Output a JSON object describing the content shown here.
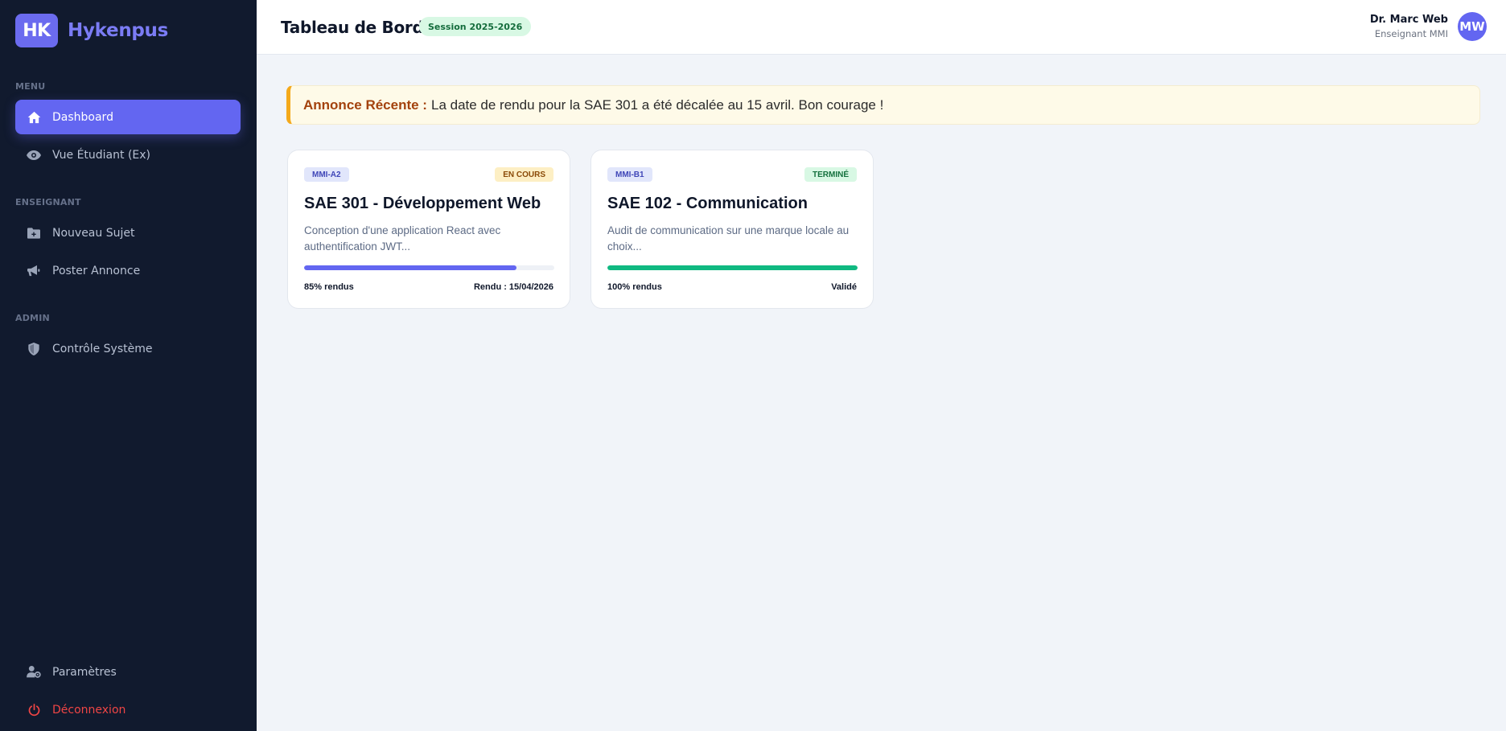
{
  "brand": {
    "logo": "HK",
    "name": "Hykenpus"
  },
  "sidebar": {
    "sections": [
      {
        "title": "MENU",
        "items": [
          {
            "label": "Dashboard",
            "icon": "home-icon",
            "active": true
          },
          {
            "label": "Vue Étudiant (Ex)",
            "icon": "eye-icon"
          }
        ]
      },
      {
        "title": "ENSEIGNANT",
        "items": [
          {
            "label": "Nouveau Sujet",
            "icon": "folder-plus-icon"
          },
          {
            "label": "Poster Annonce",
            "icon": "megaphone-icon"
          }
        ]
      },
      {
        "title": "ADMIN",
        "items": [
          {
            "label": "Contrôle Système",
            "icon": "shield-icon"
          }
        ]
      }
    ],
    "bottom": [
      {
        "label": "Paramètres",
        "icon": "user-gear-icon"
      },
      {
        "label": "Déconnexion",
        "icon": "power-icon"
      }
    ]
  },
  "header": {
    "title": "Tableau de Bord",
    "session": "Session 2025-2026",
    "user": {
      "name": "Dr. Marc Web",
      "role": "Enseignant MMI",
      "initials": "MW"
    }
  },
  "announcement": {
    "label": "Annonce Récente :",
    "text": "La date de rendu pour la SAE 301 a été décalée au 15 avril. Bon courage !"
  },
  "cards": [
    {
      "group": "MMI-A2",
      "status": "EN COURS",
      "status_bg": "#fdefc4",
      "status_fg": "#8a4a07",
      "title": "SAE 301 - Développement Web",
      "description": "Conception d'une application React avec authentification JWT...",
      "progress": 85,
      "progress_color": "#6366f1",
      "progress_label": "85% rendus",
      "right_label": "Rendu : 15/04/2026"
    },
    {
      "group": "MMI-B1",
      "status": "TERMINÉ",
      "status_bg": "#d8f8e4",
      "status_fg": "#14713e",
      "title": "SAE 102 - Communication",
      "description": "Audit de communication sur une marque locale au choix...",
      "progress": 100,
      "progress_color": "#10b981",
      "progress_label": "100% rendus",
      "right_label": "Validé"
    }
  ],
  "colors": {
    "accent": "#6366f1",
    "sidebar_bg": "#111a2e",
    "danger": "#f04545",
    "warning": "#f4a91b"
  }
}
